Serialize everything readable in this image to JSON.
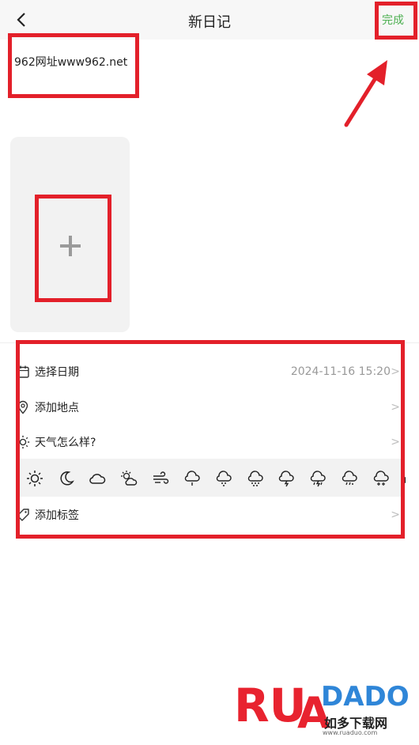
{
  "header": {
    "title": "新日记",
    "done_label": "完成"
  },
  "note": {
    "text": "962网址www962.net"
  },
  "photo": {
    "add_symbol": "+"
  },
  "rows": {
    "date": {
      "label": "选择日期",
      "value": "2024-11-16 15:20",
      "chevron": ">"
    },
    "location": {
      "label": "添加地点",
      "chevron": ">"
    },
    "weather": {
      "label": "天气怎么样?",
      "chevron": ">"
    },
    "tags": {
      "label": "添加标签",
      "chevron": ">"
    }
  },
  "weather_options": [
    "sunny",
    "night",
    "cloudy",
    "partly-cloudy",
    "windy",
    "light-rain",
    "moderate-rain",
    "heavy-rain",
    "thunderstorm",
    "thunder-rain",
    "sleet",
    "snow"
  ],
  "watermark": {
    "brand": "RUADADO",
    "cn": "如多下载网",
    "url": "www.ruaduo.com"
  },
  "colors": {
    "accent_green": "#4caf50",
    "annotation_red": "#e3202a"
  }
}
